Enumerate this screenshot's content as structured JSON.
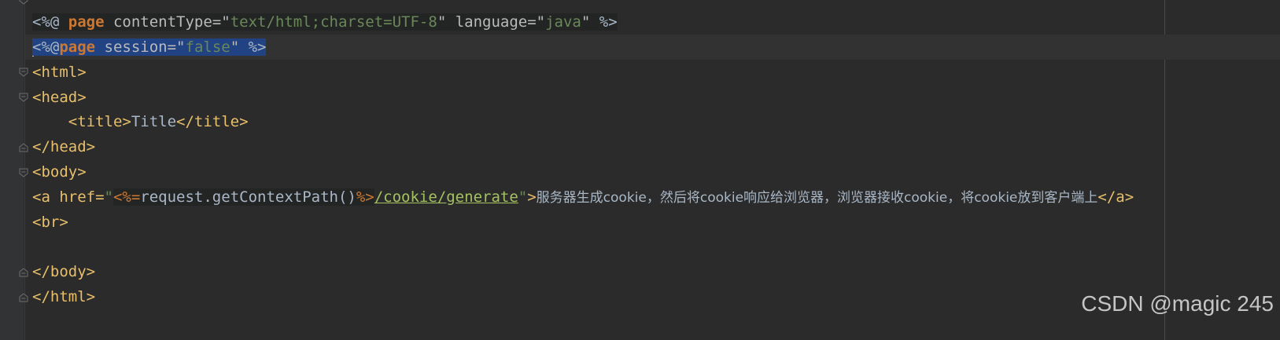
{
  "editor": {
    "line1": {
      "open": "<%@ ",
      "directive": "page",
      "attr1": " contentType=",
      "q1": "\"",
      "val1": "text/html;charset=UTF-8",
      "q1e": "\"",
      "attr2": " language=",
      "q2": "\"",
      "val2": "java",
      "q2e": "\"",
      "close": " %>"
    },
    "line2": {
      "open": "<%@",
      "directive": "page",
      "attr1": " session=",
      "q1": "\"",
      "val1": "false",
      "q1e": "\"",
      "close": " %>"
    },
    "line3": "<html>",
    "line4": "<head>",
    "line5": {
      "indent": "    ",
      "open": "<title>",
      "text": "Title",
      "close": "</title>"
    },
    "line6": "</head>",
    "line7": "<body>",
    "line8": {
      "open": "<a href=",
      "q": "\"",
      "jsp_open": "<%=",
      "expr": "request.getContextPath()",
      "jsp_close": "%>",
      "path": "/cookie/generate",
      "q_end": "\"",
      "gt": ">",
      "text": "服务器生成cookie，然后将cookie响应给浏览器，浏览器接收cookie，将cookie放到客户端上",
      "close": "</a>"
    },
    "line9": "<br>",
    "line11": "</body>",
    "line12": "</html>"
  },
  "watermark": "CSDN @magic 245"
}
